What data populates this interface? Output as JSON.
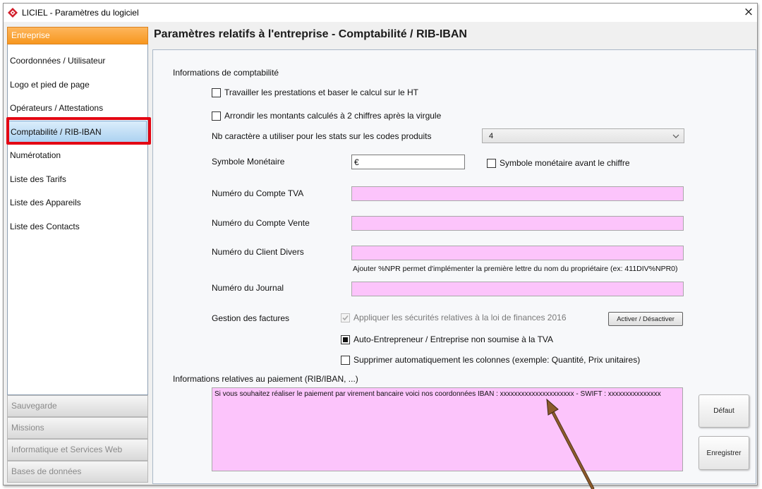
{
  "window": {
    "title": "LICIEL - Paramètres du logiciel",
    "close_glyph": "×"
  },
  "sidebar": {
    "header": "Entreprise",
    "items": [
      {
        "label": "Coordonnées / Utilisateur",
        "selected": false
      },
      {
        "label": "Logo et pied de page",
        "selected": false
      },
      {
        "label": "Opérateurs / Attestations",
        "selected": false
      },
      {
        "label": "Comptabilité / RIB-IBAN",
        "selected": true
      },
      {
        "label": "Numérotation",
        "selected": false
      },
      {
        "label": "Liste des Tarifs",
        "selected": false
      },
      {
        "label": "Liste des Appareils",
        "selected": false
      },
      {
        "label": "Liste des Contacts",
        "selected": false
      }
    ],
    "sections": [
      {
        "label": "Sauvegarde"
      },
      {
        "label": "Missions"
      },
      {
        "label": "Informatique et Services Web"
      },
      {
        "label": "Bases de données"
      }
    ]
  },
  "main": {
    "title": "Paramètres relatifs à l'entreprise - Comptabilité / RIB-IBAN",
    "accounting": {
      "heading": "Informations de comptabilité",
      "ht_checkbox": {
        "label": "Travailler les prestations et baser le calcul sur le HT",
        "checked": false
      },
      "round_checkbox": {
        "label": "Arrondir les montants calculés à 2 chiffres après la virgule",
        "checked": false
      },
      "stats_chars": {
        "label": "Nb caractère a utiliser pour les stats sur les codes produits",
        "value": "4"
      },
      "currency": {
        "label": "Symbole Monétaire",
        "value": "€"
      },
      "currency_before_checkbox": {
        "label": "Symbole monétaire avant le chiffre",
        "checked": false
      },
      "vat_account": {
        "label": "Numéro du Compte TVA",
        "value": ""
      },
      "sales_account": {
        "label": "Numéro du Compte Vente",
        "value": ""
      },
      "misc_client": {
        "label": "Numéro du Client Divers",
        "value": "",
        "hint": "Ajouter %NPR permet d'implémenter la première lettre du nom du propriétaire (ex: 411DIV%NPR0)"
      },
      "journal": {
        "label": "Numéro du Journal",
        "value": ""
      }
    },
    "invoices": {
      "label": "Gestion des factures",
      "finance_law_checkbox": {
        "label": "Appliquer les sécurités relatives à la loi de finances 2016",
        "checked": true,
        "disabled": true
      },
      "toggle_button": "Activer / Désactiver",
      "auto_entrepreneur_checkbox": {
        "label": "Auto-Entrepreneur / Entreprise non soumise à la TVA",
        "checked": true,
        "indeterminate": true
      },
      "remove_columns_checkbox": {
        "label": "Supprimer automatiquement les colonnes (exemple: Quantité, Prix unitaires)",
        "checked": false
      }
    },
    "payment": {
      "heading": "Informations relatives au paiement (RIB/IBAN, ...)",
      "text": "Si vous souhaitez réaliser le paiement par virement bancaire voici nos coordonnées IBAN : xxxxxxxxxxxxxxxxxxxxx - SWIFT : xxxxxxxxxxxxxxx"
    },
    "actions": {
      "default_label": "Défaut",
      "save_label": "Enregistrer"
    }
  },
  "icons": {
    "app": "liciel-logo-icon",
    "close": "close-icon",
    "dropdown": "chevron-down-icon",
    "checkbox_mark": "check-icon"
  },
  "colors": {
    "sidebar_header": "#f7971f",
    "selection": "#a9d0f0",
    "required_field": "#fcc4fb",
    "annotation_frame": "#e30613",
    "annotation_arrow": "#8b5a2b"
  }
}
